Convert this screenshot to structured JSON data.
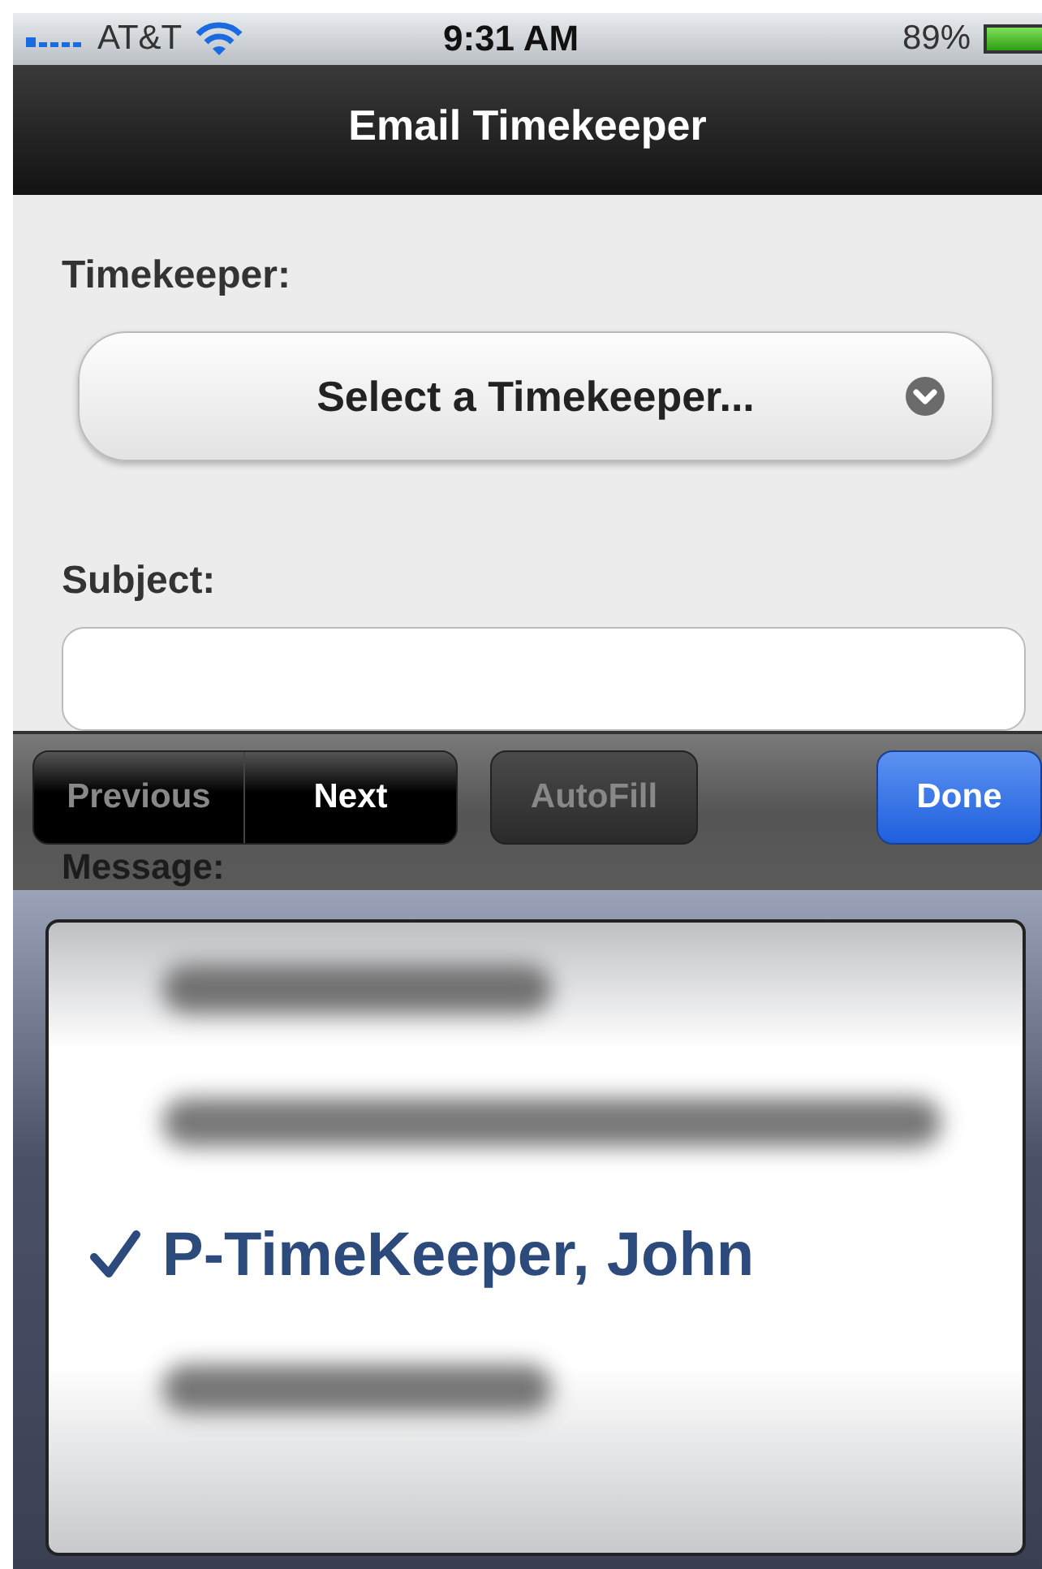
{
  "status_bar": {
    "carrier": "AT&T",
    "time": "9:31 AM",
    "battery": "89%"
  },
  "nav_bar": {
    "title": "Email Timekeeper"
  },
  "form": {
    "timekeeper_label": "Timekeeper:",
    "timekeeper_select": "Select a Timekeeper...",
    "subject_label": "Subject:",
    "message_label": "Message:"
  },
  "toolbar": {
    "buttons": [
      {
        "label": "Previous",
        "disabled": true,
        "kind": "segment"
      },
      {
        "label": "Next",
        "disabled": false,
        "kind": "segment"
      },
      {
        "label": "AutoFill",
        "disabled": true,
        "kind": "plain"
      },
      {
        "label": "Done",
        "disabled": false,
        "kind": "primary"
      }
    ]
  },
  "picker": {
    "items": [
      {
        "kind": "blurred",
        "selected": false
      },
      {
        "kind": "blurred",
        "selected": false
      },
      {
        "kind": "text",
        "label": "P-TimeKeeper, John",
        "selected": true
      },
      {
        "kind": "blurred",
        "selected": false
      }
    ]
  }
}
